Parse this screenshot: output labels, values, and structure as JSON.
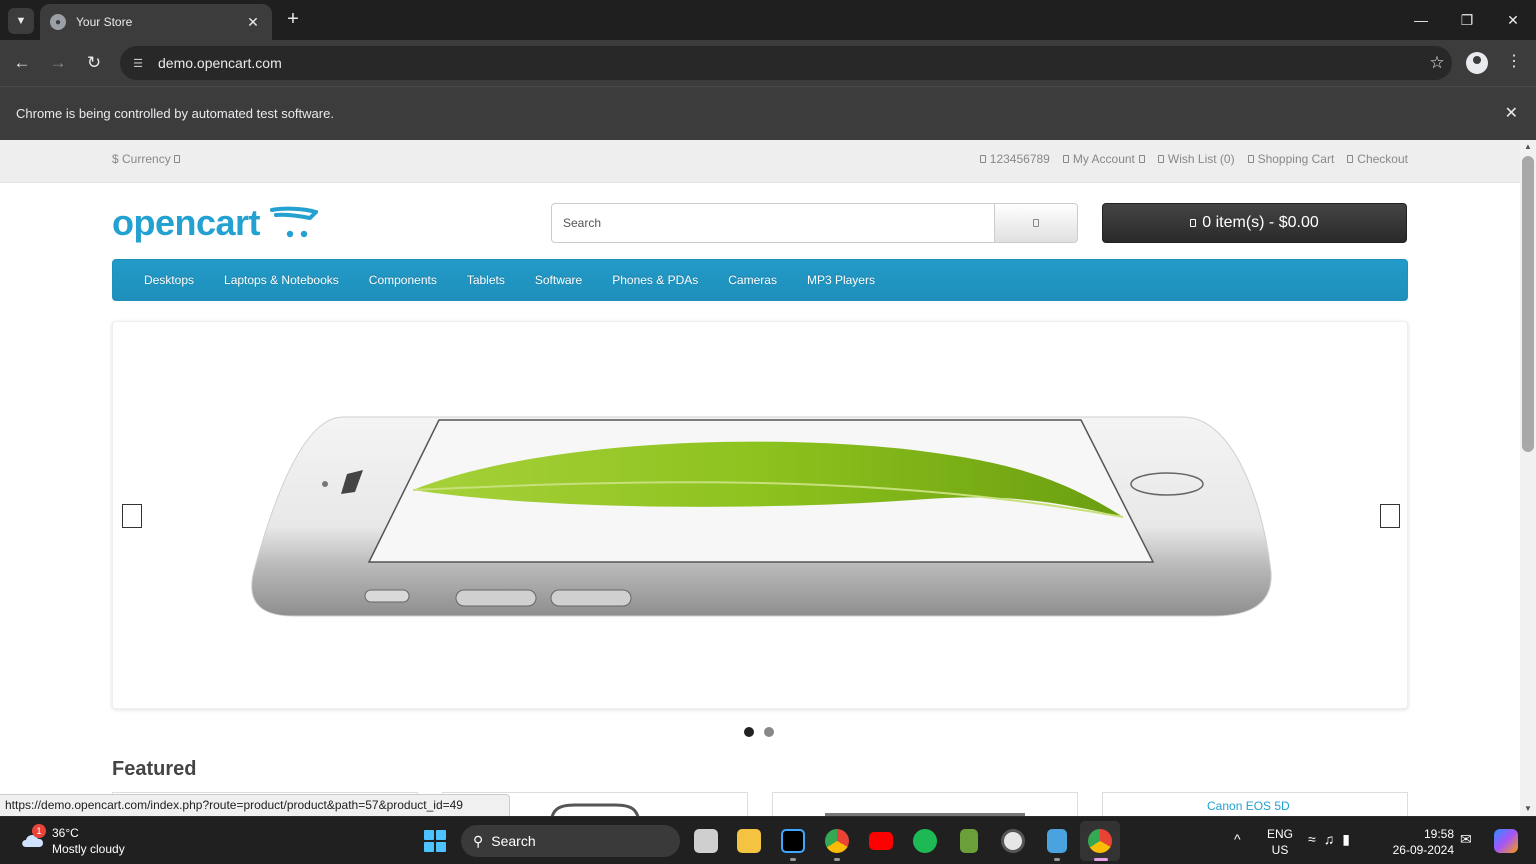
{
  "browser": {
    "tab_title": "Your Store",
    "new_tab": "+",
    "url": "demo.opencart.com",
    "infobar_text": "Chrome is being controlled by automated test software."
  },
  "store": {
    "top_bar": {
      "currency": "$ Currency",
      "phone": "123456789",
      "my_account": "My Account",
      "wish_list": "Wish List (0)",
      "shopping_cart": "Shopping Cart",
      "checkout": "Checkout"
    },
    "logo_text": "opencart",
    "search": {
      "placeholder": "Search"
    },
    "cart_button": "0 item(s) - $0.00",
    "menu": [
      "Desktops",
      "Laptops & Notebooks",
      "Components",
      "Tablets",
      "Software",
      "Phones & PDAs",
      "Cameras",
      "MP3 Players"
    ],
    "slideshow": {
      "active_slide": 1,
      "total_slides": 2
    },
    "featured_heading": "Featured",
    "broken_image_alt": "Canon EOS 5D"
  },
  "status_bar_url": "https://demo.opencart.com/index.php?route=product/product&path=57&product_id=49",
  "taskbar": {
    "weather_badge": "1",
    "weather_temp": "36°C",
    "weather_desc": "Mostly cloudy",
    "search_label": "Search",
    "lang_line1": "ENG",
    "lang_line2": "US",
    "time": "19:58",
    "date": "26-09-2024"
  },
  "colors": {
    "brand_blue": "#23a1d1",
    "menu_blue": "#229ac8",
    "cart_dark": "#303030"
  }
}
